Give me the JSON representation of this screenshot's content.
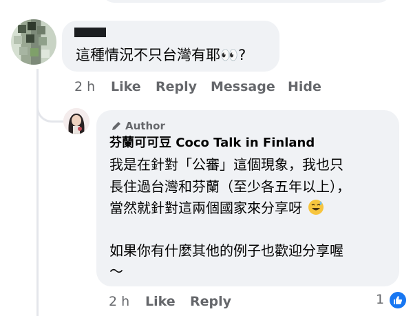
{
  "comment_1": {
    "text": "這種情況不只台灣有耶👀?",
    "time": "2 h",
    "actions": [
      "Like",
      "Reply",
      "Message",
      "Hide"
    ]
  },
  "reply": {
    "author_badge": "Author",
    "author_name": "芬蘭可可豆 Coco Talk in Finland",
    "lines": [
      "我是在針對「公審」這個現象，我也只",
      "長住過台灣和芬蘭（至少各五年以上），",
      "當然就針對這兩個國家來分享呀",
      "",
      "如果你有什麼其他的例子也歡迎分享喔",
      "～"
    ],
    "time": "2 h",
    "actions": [
      "Like",
      "Reply"
    ],
    "reaction_count": "1"
  },
  "colors": {
    "bubble": "#f0f2f5",
    "meta_text": "#65676b",
    "like_blue": "#1877f2",
    "thread_line": "#e4e6eb"
  }
}
